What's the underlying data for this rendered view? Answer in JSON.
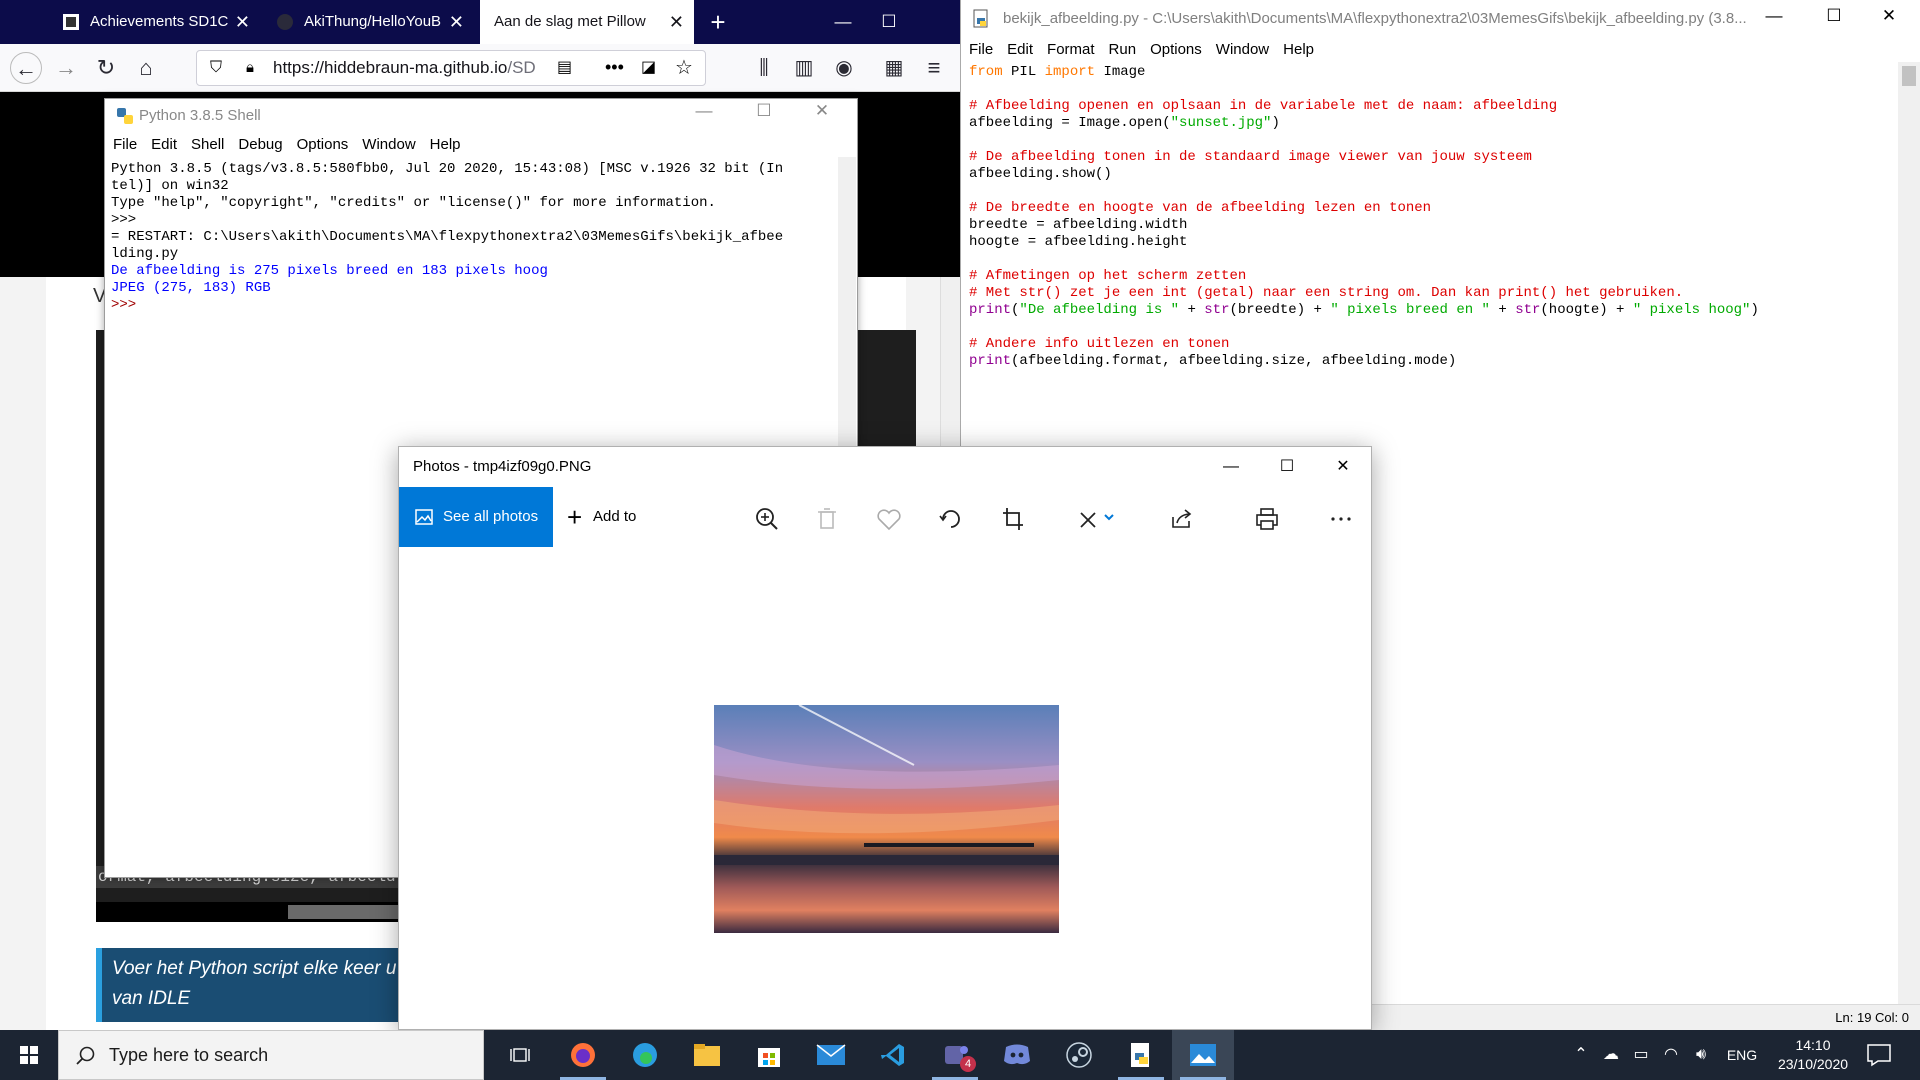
{
  "firefox": {
    "tabs": [
      {
        "title": "Achievements SD1C",
        "icon": "github-icon"
      },
      {
        "title": "AkiThung/HelloYouB",
        "icon": "github-icon"
      },
      {
        "title": "Aan de slag met Pillow",
        "icon": "page-icon"
      }
    ],
    "url_domain": "https://hiddebraun-ma.github.io",
    "url_path": "/SD",
    "code_snippet": "ormat, afbeelding.size, afbeeld",
    "note_text": "Voer het Python script elke keer u van IDLE",
    "page_letter": "V"
  },
  "idle_editor": {
    "title": "bekijk_afbeelding.py - C:\\Users\\akith\\Documents\\MA\\flexpythonextra2\\03MemesGifs\\bekijk_afbeelding.py (3.8...",
    "menu": [
      "File",
      "Edit",
      "Format",
      "Run",
      "Options",
      "Window",
      "Help"
    ],
    "status": "Ln: 19  Col: 0",
    "code": {
      "l1_from": "from",
      "l1_mid": " PIL ",
      "l1_import": "import",
      "l1_rest": " Image",
      "c1": "# Afbeelding openen en oplsaan in de variabele met de naam: afbeelding",
      "l2_a": "afbeelding = Image.open(",
      "l2_str": "\"sunset.jpg\"",
      "l2_b": ")",
      "c2": "# De afbeelding tonen in de standaard image viewer van jouw systeem",
      "l3": "afbeelding.show()",
      "c3": "# De breedte en hoogte van de afbeelding lezen en tonen",
      "l4": "breedte = afbeelding.width",
      "l5": "hoogte = afbeelding.height",
      "c4": "# Afmetingen op het scherm zetten",
      "c5": "# Met str() zet je een int (getal) naar een string om. Dan kan print() het gebruiken.",
      "l6_print": "print",
      "l6_a": "(",
      "l6_s1": "\"De afbeelding is \"",
      "l6_b": " + ",
      "l6_str1": "str",
      "l6_c": "(breedte) + ",
      "l6_s2": "\" pixels breed en \"",
      "l6_d": " + ",
      "l6_str2": "str",
      "l6_e": "(hoogte) + ",
      "l6_s3": "\" pixels hoog\"",
      "l6_f": ")",
      "c6": "# Andere info uitlezen en tonen",
      "l7_print": "print",
      "l7_rest": "(afbeelding.format, afbeelding.size, afbeelding.mode)"
    }
  },
  "shell": {
    "title": "Python 3.8.5 Shell",
    "menu": [
      "File",
      "Edit",
      "Shell",
      "Debug",
      "Options",
      "Window",
      "Help"
    ],
    "lines": [
      "Python 3.8.5 (tags/v3.8.5:580fbb0, Jul 20 2020, 15:43:08) [MSC v.1926 32 bit (In",
      "tel)] on win32",
      "Type \"help\", \"copyright\", \"credits\" or \"license()\" for more information.",
      ">>> ",
      "= RESTART: C:\\Users\\akith\\Documents\\MA\\flexpythonextra2\\03MemesGifs\\bekijk_afbee",
      "lding.py"
    ],
    "output": [
      "De afbeelding is 275 pixels breed en 183 pixels hoog",
      "JPEG (275, 183) RGB"
    ],
    "prompt": ">>> "
  },
  "photos": {
    "title": "Photos - tmp4izf09g0.PNG",
    "see_all": "See all photos",
    "add_to": "Add to",
    "tools": [
      "zoom-icon",
      "delete-icon",
      "favorite-icon",
      "rotate-icon",
      "crop-icon",
      "edit-icon",
      "share-icon",
      "print-icon",
      "more-icon"
    ]
  },
  "taskbar": {
    "search_placeholder": "Type here to search",
    "apps": [
      "task-view-icon",
      "firefox-icon",
      "edge-icon",
      "file-explorer-icon",
      "store-icon",
      "mail-icon",
      "vscode-icon",
      "teams-icon",
      "discord-icon",
      "steam-icon",
      "python-idle-icon",
      "photos-icon"
    ],
    "teams_badge": "4",
    "language": "ENG",
    "time": "14:10",
    "date": "23/10/2020"
  }
}
